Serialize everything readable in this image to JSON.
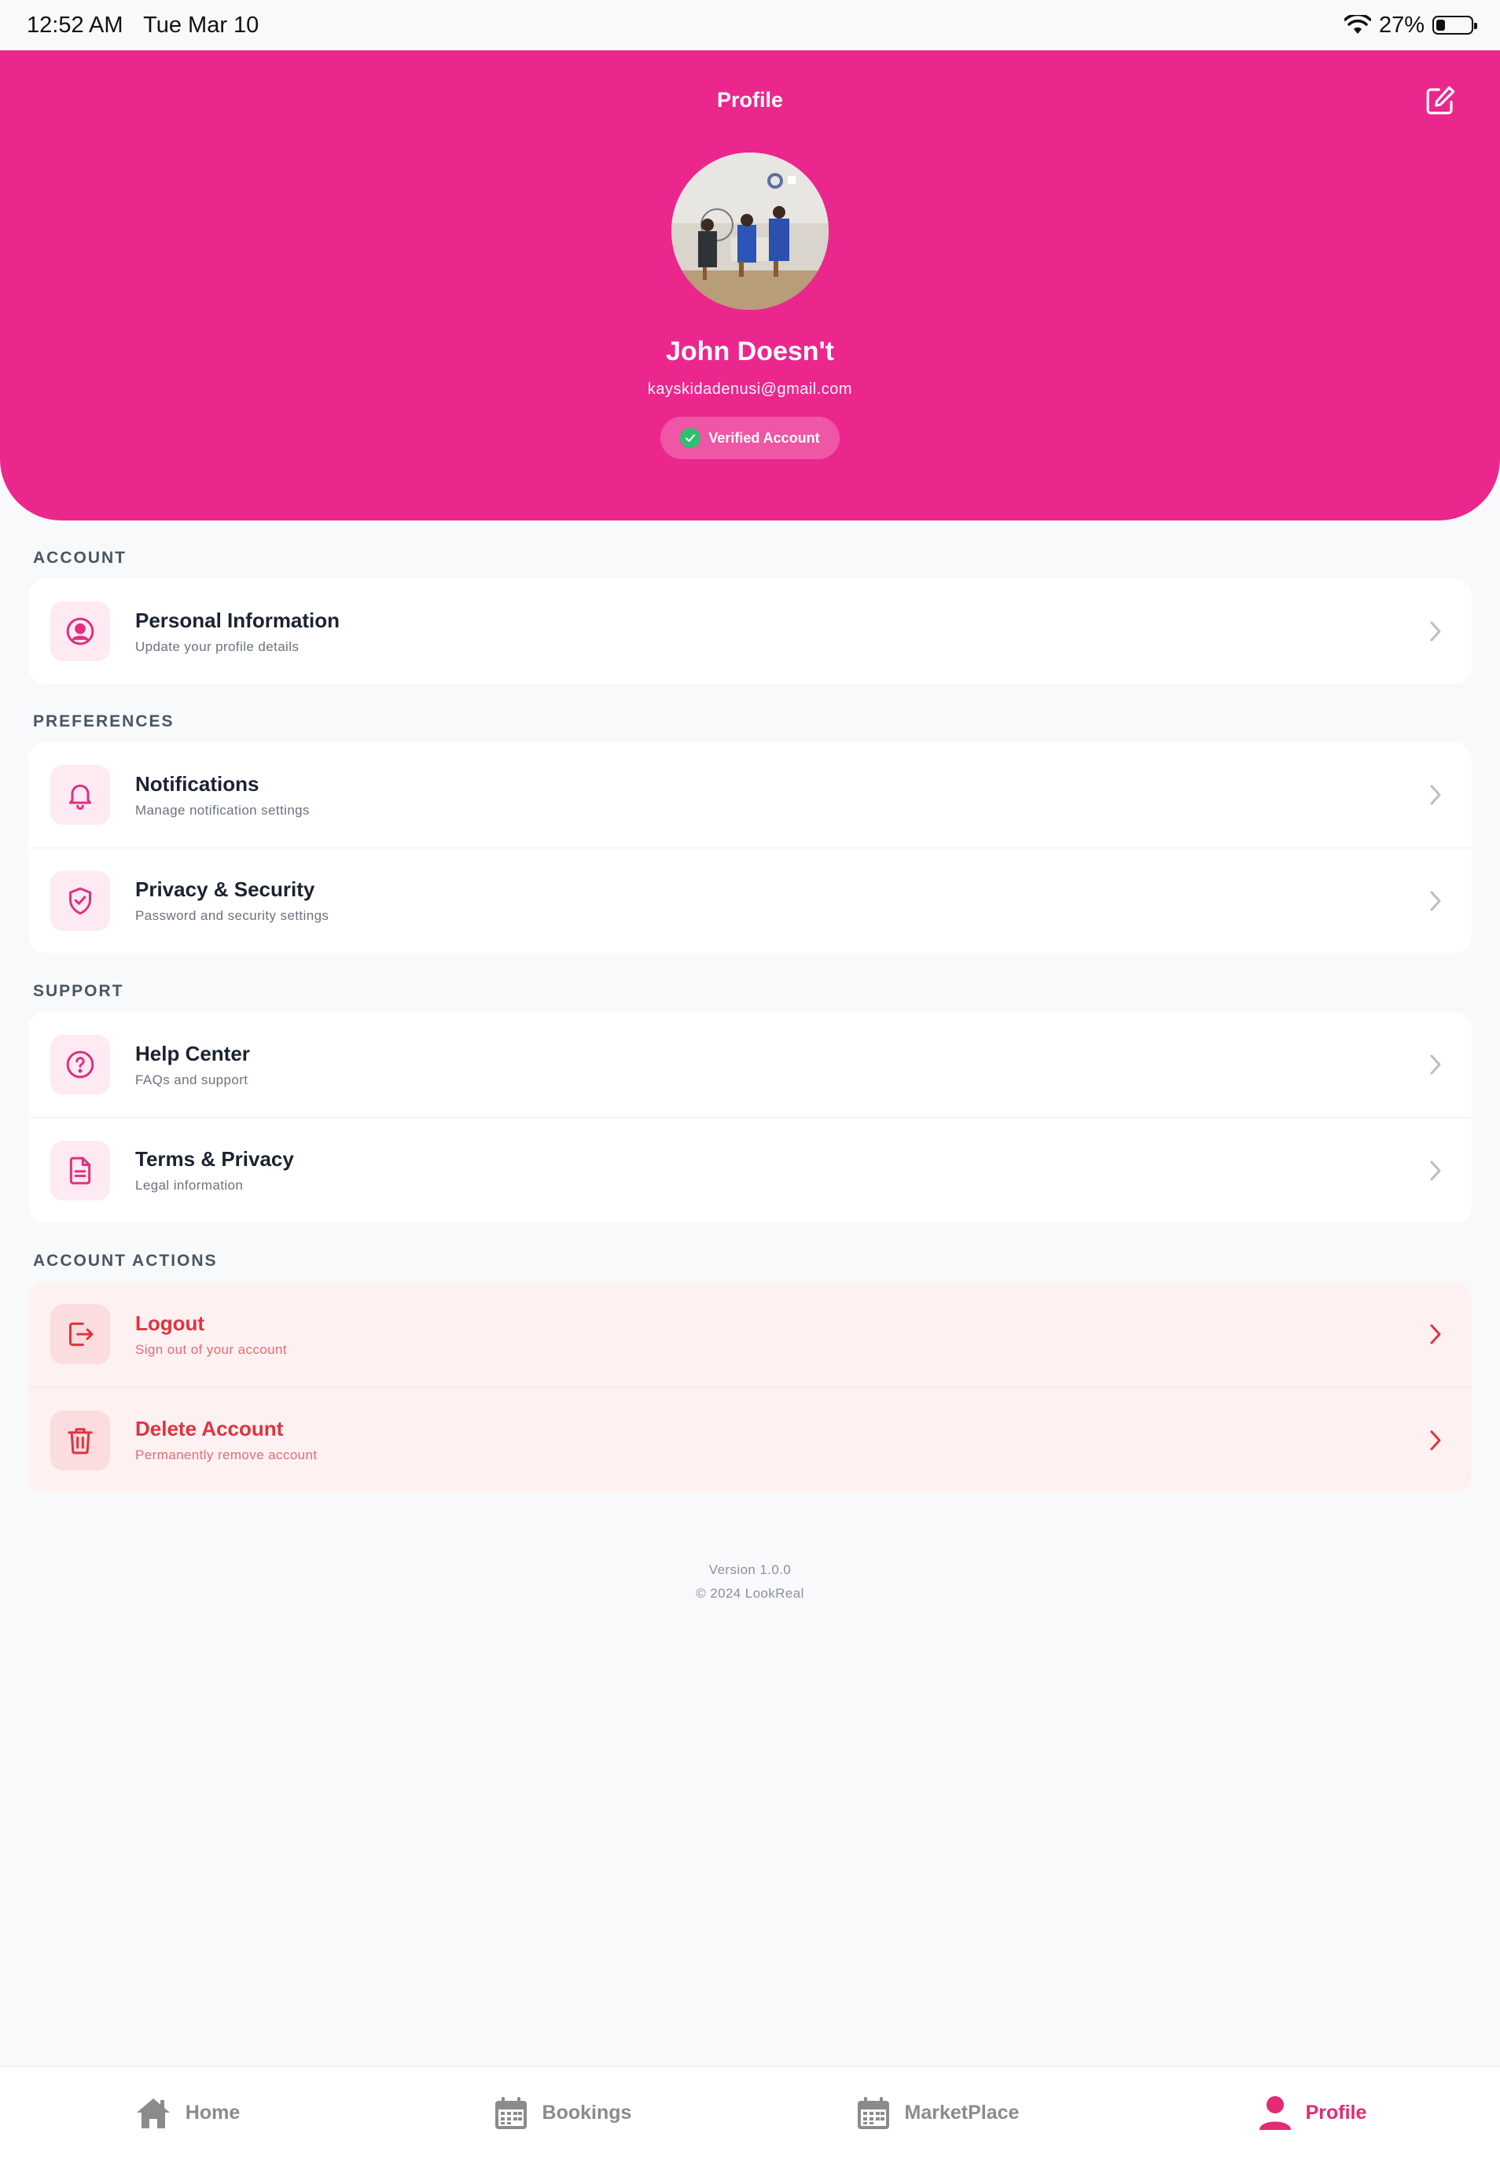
{
  "status_bar": {
    "time": "12:52 AM",
    "date": "Tue Mar 10",
    "battery": "27%"
  },
  "header": {
    "title": "Profile",
    "name": "John Doesn't",
    "email": "kayskidadenusi@gmail.com",
    "badge": "Verified Account"
  },
  "sections": {
    "account": {
      "label": "ACCOUNT",
      "items": [
        {
          "title": "Personal Information",
          "subtitle": "Update your profile details",
          "icon": "user-circle-icon"
        }
      ]
    },
    "preferences": {
      "label": "PREFERENCES",
      "items": [
        {
          "title": "Notifications",
          "subtitle": "Manage notification settings",
          "icon": "bell-icon"
        },
        {
          "title": "Privacy & Security",
          "subtitle": "Password and security settings",
          "icon": "shield-check-icon"
        }
      ]
    },
    "support": {
      "label": "SUPPORT",
      "items": [
        {
          "title": "Help Center",
          "subtitle": "FAQs and support",
          "icon": "help-circle-icon"
        },
        {
          "title": "Terms & Privacy",
          "subtitle": "Legal information",
          "icon": "document-icon"
        }
      ]
    },
    "actions": {
      "label": "ACCOUNT ACTIONS",
      "items": [
        {
          "title": "Logout",
          "subtitle": "Sign out of your account",
          "icon": "logout-icon"
        },
        {
          "title": "Delete Account",
          "subtitle": "Permanently remove account",
          "icon": "trash-icon"
        }
      ]
    }
  },
  "footer": {
    "version": "Version 1.0.0",
    "copyright": "© 2024 LookReal"
  },
  "tabbar": {
    "items": [
      {
        "label": "Home",
        "icon": "home-icon",
        "active": false
      },
      {
        "label": "Bookings",
        "icon": "calendar-icon",
        "active": false
      },
      {
        "label": "MarketPlace",
        "icon": "calendar-icon",
        "active": false
      },
      {
        "label": "Profile",
        "icon": "user-icon",
        "active": true
      }
    ]
  },
  "colors": {
    "brand": "#eb278d",
    "danger": "#e0333f",
    "active_tab": "#e32a74"
  }
}
